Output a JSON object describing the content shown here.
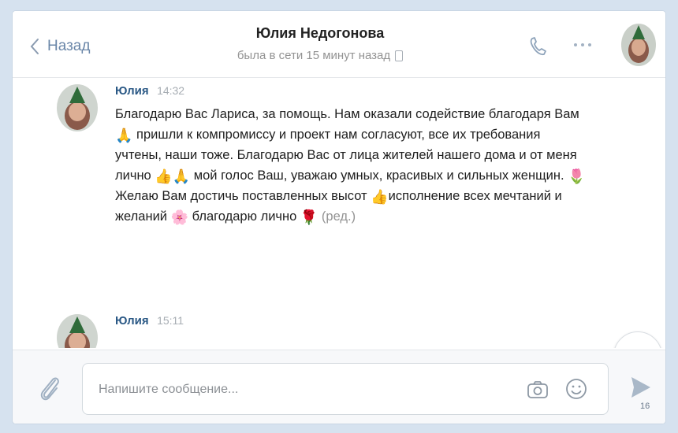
{
  "header": {
    "back_label": "Назад",
    "title": "Юлия Недогонова",
    "status": "была в сети 15 минут назад"
  },
  "messages": [
    {
      "author": "Юлия",
      "time": "14:32",
      "text_parts": {
        "p1": "Благодарю Вас Лариса, за помощь. Нам оказали содействие благодаря Вам",
        "p2": "пришли к компромиссу и проект нам согласуют, все их требования учтены, наши тоже. Благодарю Вас от лица жителей нашего дома и от меня лично",
        "p3": "мой голос Ваш, уважаю умных, красивых и сильных женщин.",
        "p4": "Желаю Вам достичь поставленных высот",
        "p5": "исполнение всех мечтаний и желаний",
        "p6": "благодарю лично",
        "edited": "(ред.)"
      },
      "emoji": {
        "e1": "🙏",
        "e2": "👍",
        "e3": "🙏",
        "e4": "🌷",
        "e5": "👍",
        "e6": "🌸",
        "e7": "🌹"
      }
    },
    {
      "author": "Юлия",
      "time": "15:11"
    }
  ],
  "composer": {
    "placeholder": "Напишите сообщение..."
  },
  "page_number": "16",
  "icons": {
    "back": "chevron-left-icon",
    "call": "phone-icon",
    "more": "more-icon",
    "scroll": "chevron-down-icon",
    "attach": "paperclip-icon",
    "camera": "camera-icon",
    "emoji": "smiley-icon",
    "send": "send-icon"
  },
  "colors": {
    "accent": "#5181b8",
    "name": "#2a5885",
    "background": "#d6e2ef"
  }
}
